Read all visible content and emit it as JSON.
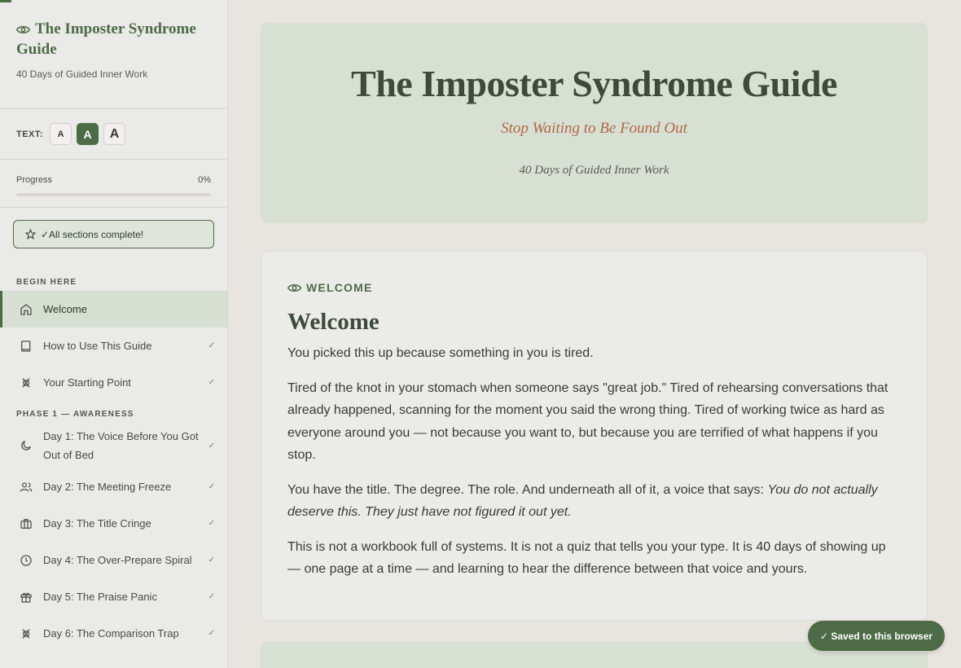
{
  "sidebar": {
    "title": "The Imposter Syndrome Guide",
    "subtitle": "40 Days of Guided Inner Work",
    "text_size_label": "TEXT:",
    "text_size_options": [
      "A",
      "A",
      "A"
    ],
    "progress_label": "Progress",
    "progress_value": "0%",
    "progress_fraction": 0,
    "complete_badge": "✓All sections complete!",
    "sections": [
      {
        "label": "BEGIN HERE",
        "items": [
          {
            "label": "Welcome",
            "icon": "home-icon",
            "active": true,
            "check": ""
          },
          {
            "label": "How to Use This Guide",
            "icon": "book-icon",
            "check": "✓"
          },
          {
            "label": "Your Starting Point",
            "icon": "compass-icon",
            "check": "✓"
          }
        ]
      },
      {
        "label": "PHASE 1 — AWARENESS",
        "items": [
          {
            "label": "Day 1: The Voice Before You Got Out of Bed",
            "icon": "moon-icon",
            "check": "✓"
          },
          {
            "label": "Day 2: The Meeting Freeze",
            "icon": "users-icon",
            "check": "✓"
          },
          {
            "label": "Day 3: The Title Cringe",
            "icon": "briefcase-icon",
            "check": "✓"
          },
          {
            "label": "Day 4: The Over-Prepare Spiral",
            "icon": "clock-icon",
            "check": "✓"
          },
          {
            "label": "Day 5: The Praise Panic",
            "icon": "gift-icon",
            "check": "✓"
          },
          {
            "label": "Day 6: The Comparison Trap",
            "icon": "compass-icon",
            "check": "✓"
          }
        ]
      }
    ]
  },
  "hero": {
    "title": "The Imposter Syndrome Guide",
    "subtitle": "Stop Waiting to Be Found Out",
    "tagline": "40 Days of Guided Inner Work"
  },
  "card": {
    "kicker": "WELCOME",
    "title": "Welcome",
    "p1": "You picked this up because something in you is tired.",
    "p2": "Tired of the knot in your stomach when someone says \"great job.\" Tired of rehearsing conversations that already happened, scanning for the moment you said the wrong thing. Tired of working twice as hard as everyone around you — not because you want to, but because you are terrified of what happens if you stop.",
    "p3_plain": "You have the title. The degree. The role. And underneath all of it, a voice that says: ",
    "p3_italic": "You do not actually deserve this. They just have not figured it out yet.",
    "p4": "This is not a workbook full of systems. It is not a quiz that tells you your type. It is 40 days of showing up — one page at a time — and learning to hear the difference between that voice and yours."
  },
  "toast": "✓ Saved to this browser",
  "colors": {
    "accent": "#4d6b46",
    "hero_bg": "#d8dfd3",
    "subtitle": "#b06848",
    "active_nav": "#d7dfd2"
  }
}
